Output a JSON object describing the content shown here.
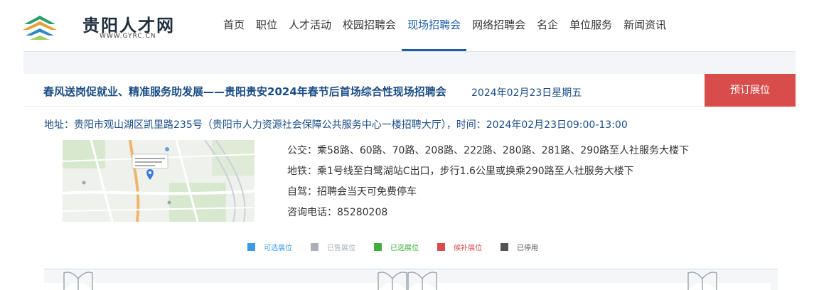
{
  "site": {
    "name": "贵阳人才网",
    "domain_text": "WWW.GYRC.CN"
  },
  "nav": {
    "items": [
      {
        "label": "首页"
      },
      {
        "label": "职位"
      },
      {
        "label": "人才活动"
      },
      {
        "label": "校园招聘会"
      },
      {
        "label": "现场招聘会",
        "active": true
      },
      {
        "label": "网络招聘会"
      },
      {
        "label": "名企"
      },
      {
        "label": "单位服务"
      },
      {
        "label": "新闻资讯"
      }
    ]
  },
  "fair": {
    "title": "春风送岗促就业、精准服务助发展——贵阳贵安2024年春节后首场综合性现场招聘会",
    "date": "2024年02月23日星期五",
    "book_label": "预订展位",
    "address": "地址：贵阳市观山湖区凯里路235号（贵阳市人力资源社会保障公共服务中心一楼招聘大厅），时间：2024年02月23日09:00-13:00"
  },
  "info": {
    "bus": "公交：乘58路、60路、70路、208路、222路、280路、281路、290路至人社服务大楼下",
    "metro": "地铁：乘1号线至白鹭湖站C出口，步行1.6公里或换乘290路至人社服务大楼下",
    "drive": "自驾：招聘会当天可免费停车",
    "phone": "咨询电话：85280208"
  },
  "legend": [
    {
      "label": "可选展位",
      "color": "#3b9be8",
      "text_color": "#3b9be8"
    },
    {
      "label": "已售展位",
      "color": "#a9b0b8",
      "text_color": "#a9b0b8"
    },
    {
      "label": "已选展位",
      "color": "#3fae3f",
      "text_color": "#3fae3f"
    },
    {
      "label": "候补展位",
      "color": "#d94c4c",
      "text_color": "#d94c4c"
    },
    {
      "label": "已停用",
      "color": "#555555",
      "text_color": "#555555"
    }
  ],
  "colors": {
    "brand_blue": "#1d5fa6",
    "title_blue": "#1b4d85",
    "book_red": "#d94c4c"
  }
}
